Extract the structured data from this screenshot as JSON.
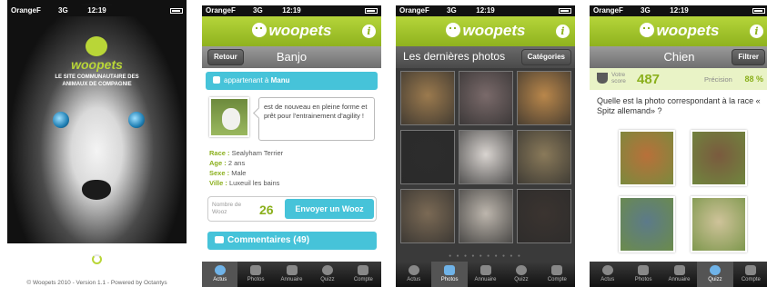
{
  "status": {
    "carrier": "OrangeF",
    "network": "3G",
    "time": "12:19"
  },
  "app": {
    "logo": "woopets",
    "info_icon": "i"
  },
  "splash": {
    "tagline": "LE SITE COMMUNAUTAIRE DES ANIMAUX DE COMPAGNIE",
    "footer": "© Woopets 2010 - Version 1.1 - Powered by Octantys"
  },
  "profile": {
    "back_label": "Retour",
    "title": "Banjo",
    "owner_prefix": "appartenant à",
    "owner_name": "Manu",
    "bubble": "est de nouveau en pleine forme et prêt pour l'entrainement d'agility !",
    "facts": [
      {
        "key": "Race :",
        "value": "Sealyham Terrier"
      },
      {
        "key": "Age :",
        "value": "2 ans"
      },
      {
        "key": "Sexe :",
        "value": "Male"
      },
      {
        "key": "Ville :",
        "value": "Luxeuil les bains"
      }
    ],
    "wooz_label": "Nombre de Wooz",
    "wooz_count": "26",
    "wooz_button": "Envoyer un Wooz",
    "comments": "Commentaires (49)"
  },
  "photos": {
    "title": "Les dernières photos",
    "categories_label": "Catégories",
    "dots": "● ● ● ● ● ● ● ● ● ●",
    "tiles": [
      {
        "name": "tabby-cat-photo",
        "color": "#9b7a4e"
      },
      {
        "name": "kitten-photo",
        "color": "#7a6a6a"
      },
      {
        "name": "golden-dog-photo",
        "color": "#b9874b"
      },
      {
        "name": "black-cat-photo",
        "color": "#2c2c2c"
      },
      {
        "name": "white-cat-photo",
        "color": "#d9d4d0"
      },
      {
        "name": "tabby-face-photo",
        "color": "#8a7a5a"
      },
      {
        "name": "pony-photo",
        "color": "#7b6a55"
      },
      {
        "name": "rabbit-photo",
        "color": "#bdb6ad"
      },
      {
        "name": "black-dog-photo",
        "color": "#3b3430"
      }
    ]
  },
  "quiz": {
    "title": "Chien",
    "filter_label": "Filtrer",
    "score_label": "Votre score",
    "score": "487",
    "precision_label": "Précision",
    "precision": "88 %",
    "question": "Quelle est la photo correspondant à la race « Spitz allemand» ?",
    "choices": [
      {
        "name": "pomeranian-photo",
        "color": "#b8703a"
      },
      {
        "name": "brown-dog-photo",
        "color": "#7a5a3e"
      },
      {
        "name": "spotted-dog-photo",
        "color": "#5c7a8a"
      },
      {
        "name": "labrador-photo",
        "color": "#cfc39a"
      }
    ]
  },
  "tabs": {
    "actus": "Actus",
    "photos": "Photos",
    "annuaire": "Annuaire",
    "quizz": "Quizz",
    "compte": "Compte"
  }
}
